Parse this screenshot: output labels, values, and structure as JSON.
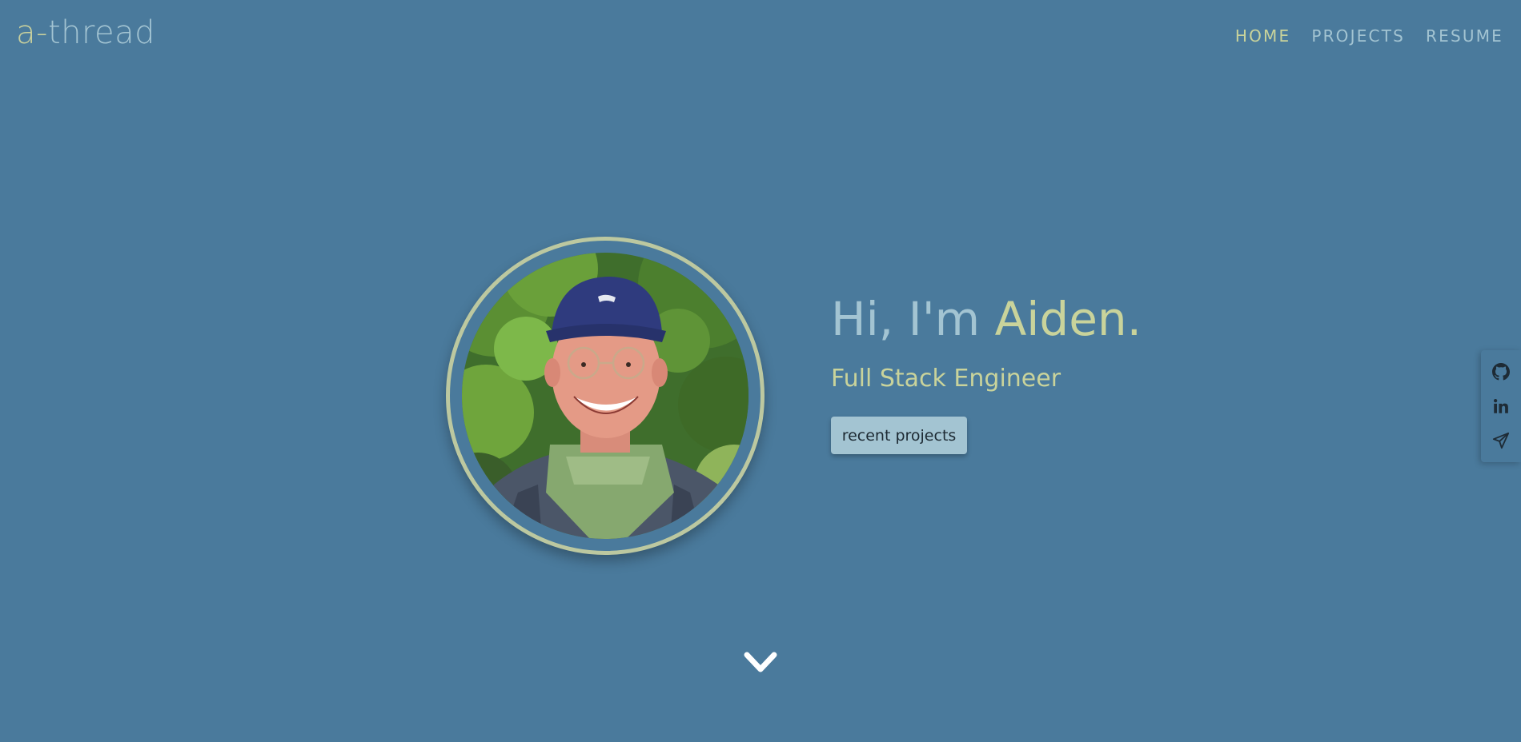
{
  "brand": {
    "prefix": "a-",
    "name": "thread"
  },
  "nav": {
    "items": [
      {
        "label": "HOME",
        "active": true
      },
      {
        "label": "PROJECTS",
        "active": false
      },
      {
        "label": "RESUME",
        "active": false
      }
    ]
  },
  "hero": {
    "greeting": "Hi, I'm ",
    "name": "Aiden.",
    "subtitle": "Full Stack Engineer",
    "cta_label": "recent projects",
    "avatar_alt": "portrait photo"
  },
  "social": {
    "items": [
      {
        "icon": "github-icon"
      },
      {
        "icon": "linkedin-icon"
      },
      {
        "icon": "send-icon"
      }
    ]
  },
  "scroll": {
    "icon": "chevron-down-icon"
  },
  "colors": {
    "background": "#4a7a9c",
    "accent": "#c9d39b",
    "muted": "#a3c4d2",
    "ring": "#bcc8a0"
  }
}
